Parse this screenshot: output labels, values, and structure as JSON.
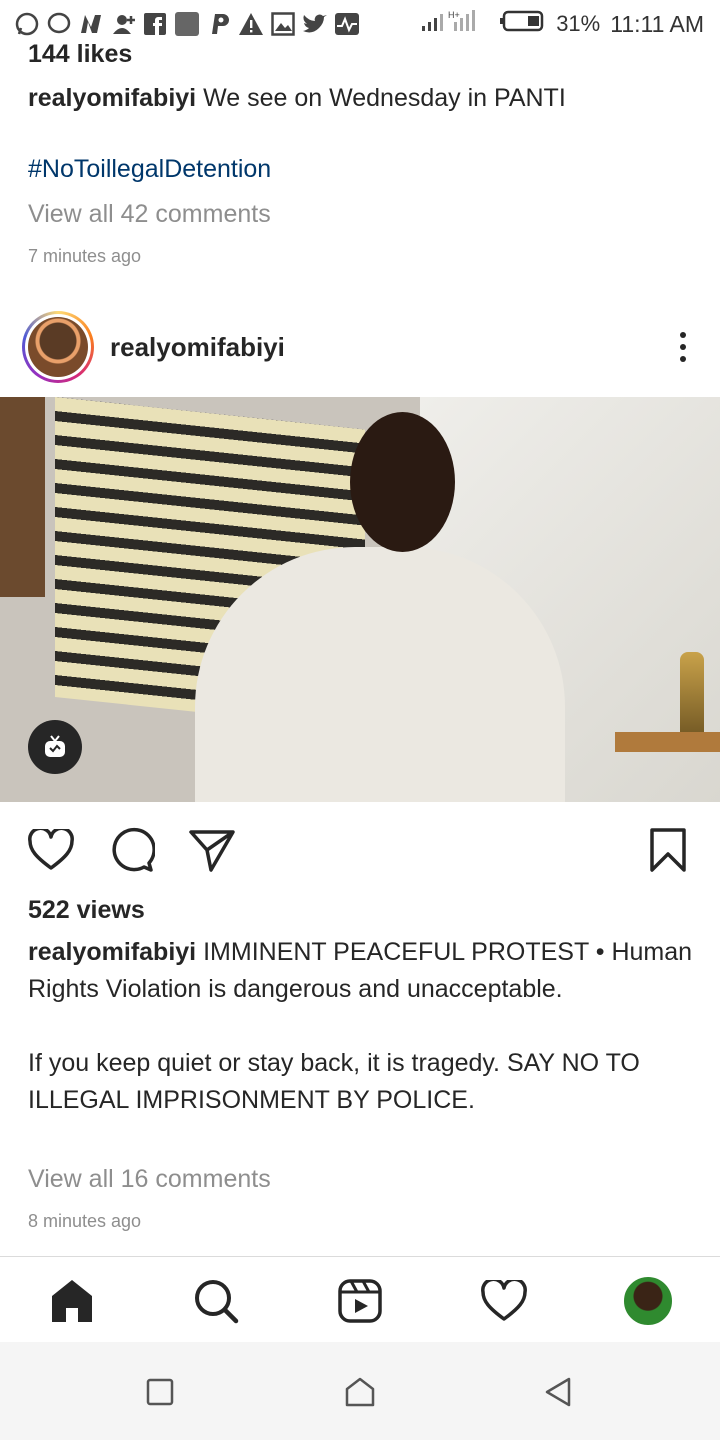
{
  "status_bar": {
    "battery_percent": "31%",
    "time": "11:11 AM",
    "notification_icons": [
      "whatsapp-icon",
      "messenger-icon",
      "nairaland-icon",
      "add-person-icon",
      "facebook-icon",
      "app-square-icon",
      "paypal-icon",
      "alert-icon",
      "gallery-icon",
      "twitter-icon",
      "pulse-icon"
    ]
  },
  "previous_post": {
    "likes": "144 likes",
    "username": "realyomifabiyi",
    "caption": "We see on Wednesday in PANTI",
    "hashtag": "#NoToillegalDetention",
    "view_comments": "View all 42 comments",
    "time_ago": "7 minutes ago"
  },
  "post": {
    "username": "realyomifabiyi",
    "views": "522 views",
    "caption_username": "realyomifabiyi",
    "caption_line1": "IMMINENT PEACEFUL PROTEST • Human Rights Violation is dangerous and unacceptable.",
    "caption_line2": "If you keep quiet or stay back, it is tragedy. SAY NO TO ILLEGAL IMPRISONMENT BY POLICE.",
    "view_comments": "View all 16 comments",
    "time_ago": "8 minutes ago"
  },
  "colors": {
    "text": "#262626",
    "muted": "#8e8e8e",
    "hashtag": "#00376b"
  }
}
